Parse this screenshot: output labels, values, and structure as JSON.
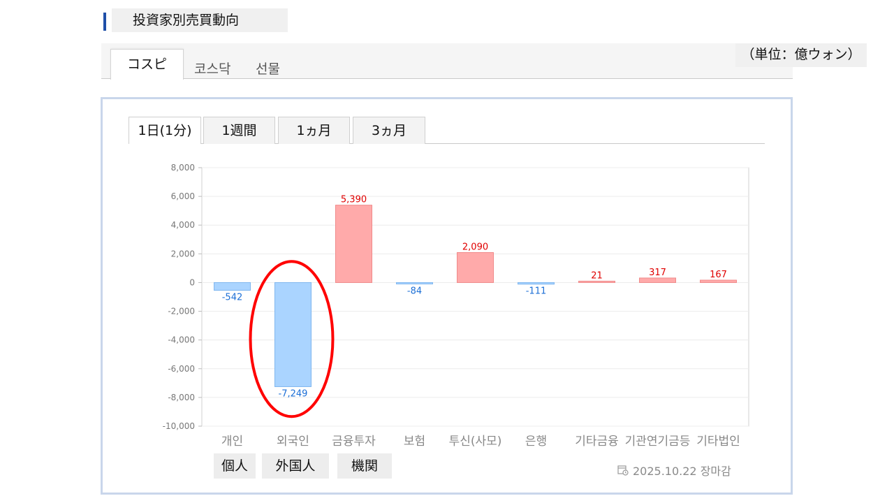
{
  "header": {
    "title": "投資家別売買動向"
  },
  "market_tabs": [
    {
      "label": "コスピ",
      "active": true
    },
    {
      "label": "코스닥",
      "active": false
    },
    {
      "label": "선물",
      "active": false
    }
  ],
  "unit_label": "（単位：億ウォン）",
  "period_tabs": [
    {
      "label": "1日(1分)",
      "active": true
    },
    {
      "label": "1週間",
      "active": false
    },
    {
      "label": "1ヵ月",
      "active": false
    },
    {
      "label": "3ヵ月",
      "active": false
    }
  ],
  "group_labels": [
    "個人",
    "外国人",
    "機関"
  ],
  "closing_note": "2025.10.22 장마감",
  "colors": {
    "positive_fill": "#ffaaaa",
    "positive_text": "#e00000",
    "negative_fill": "#aad4ff",
    "negative_text": "#1c6fd6",
    "highlight": "#ff0000"
  },
  "chart_data": {
    "type": "bar",
    "categories": [
      "개인",
      "외국인",
      "금융투자",
      "보험",
      "투신(사모)",
      "은행",
      "기타금융",
      "기관연기금등",
      "기타법인"
    ],
    "values": [
      -542,
      -7249,
      5390,
      -84,
      2090,
      -111,
      21,
      317,
      167
    ],
    "value_labels": [
      "-542",
      "-7,249",
      "5,390",
      "-84",
      "2,090",
      "-111",
      "21",
      "317",
      "167"
    ],
    "y_ticks": [
      "8,000",
      "6,000",
      "4,000",
      "2,000",
      "0",
      "-2,000",
      "-4,000",
      "-6,000",
      "-8,000",
      "-10,000"
    ],
    "ylim": [
      -10000,
      8000
    ],
    "title": "",
    "xlabel": "",
    "ylabel": "",
    "grid": true,
    "highlighted_category": "외국인"
  }
}
